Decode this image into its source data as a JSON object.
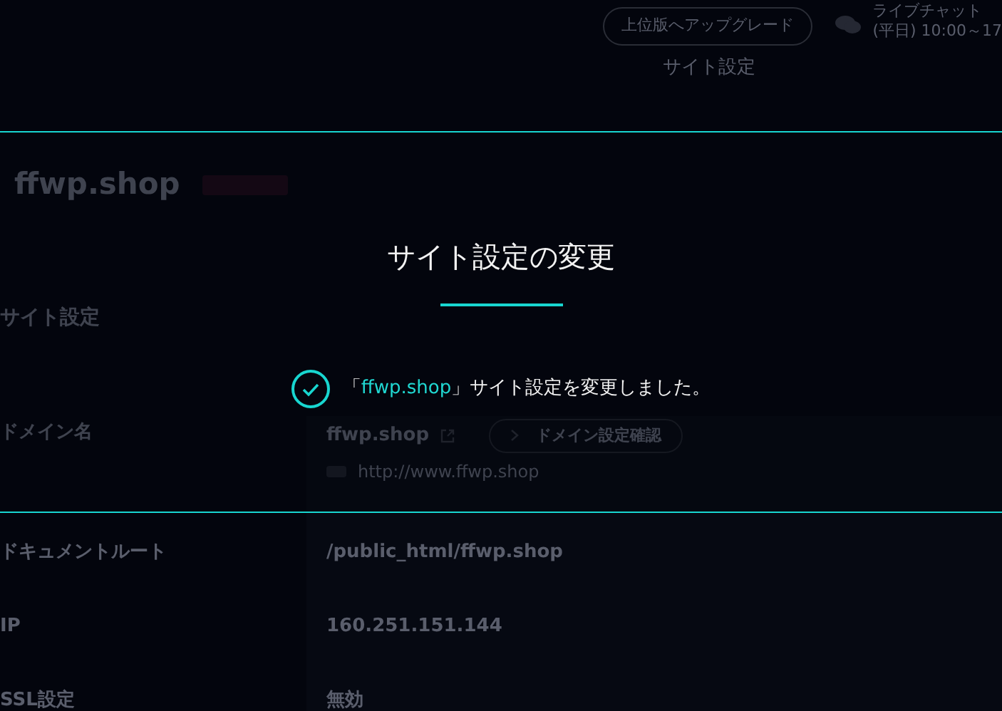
{
  "header": {
    "upgrade_button": "上位版へアップグレード",
    "live_chat": {
      "title": "ライブチャット",
      "hours": "(平日) 10:00～17"
    },
    "page_title": "サイト設定"
  },
  "site": {
    "name": "ffwp.shop"
  },
  "section_title": "サイト設定",
  "rows": [
    {
      "kind": "domain",
      "label": "ドメイン名",
      "value": "ffwp.shop",
      "button": "ドメイン設定確認",
      "url": "http://www.ffwp.shop"
    },
    {
      "kind": "text",
      "label": "ドキュメントルート",
      "value": "/public_html/ffwp.shop"
    },
    {
      "kind": "text",
      "label": "IP",
      "value": "160.251.151.144"
    },
    {
      "kind": "text",
      "label": "SSL設定",
      "value": "無効"
    }
  ],
  "modal": {
    "title": "サイト設定の変更",
    "message_prefix": "「",
    "message_highlight": "ffwp.shop",
    "message_suffix": "」サイト設定を変更しました。"
  }
}
